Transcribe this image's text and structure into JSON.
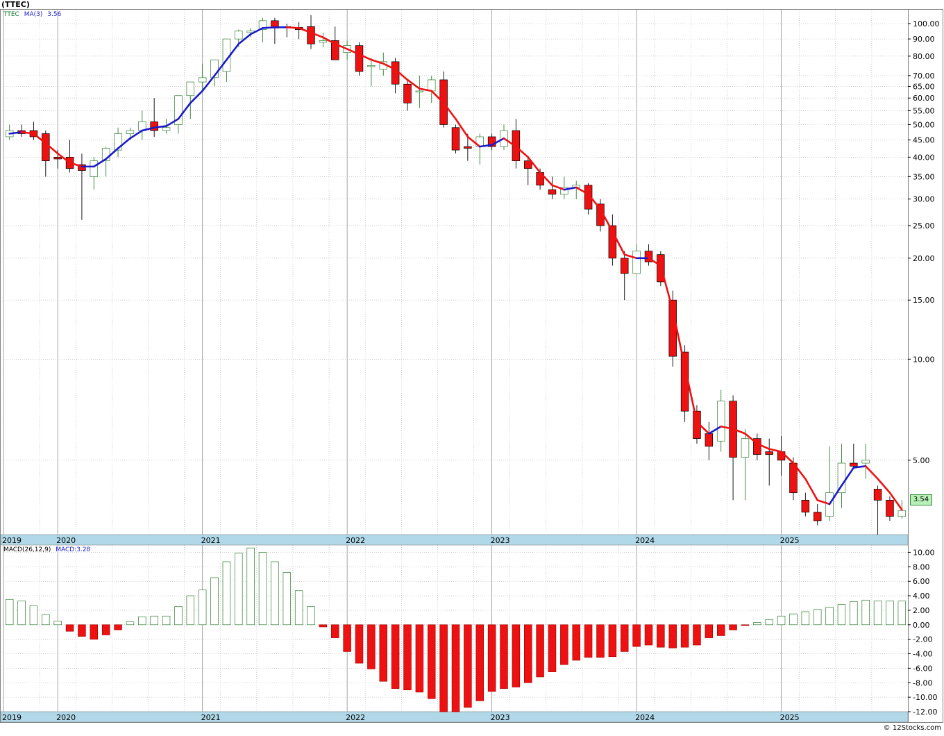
{
  "title": "(TTEC)",
  "legend": {
    "ticker": "TTEC",
    "ma_label": "MA(3)",
    "ma_value": "3.56"
  },
  "macd_legend": {
    "label": "MACD(26,12,9)",
    "value_label": "MACD:3.28"
  },
  "last_price_label": "3.54",
  "credit": "© 12Stocks.com",
  "colors": {
    "up": "#2e7d2e",
    "down": "#ee1111",
    "ma_up": "#1a1acc",
    "ma_down": "#ee1111",
    "grid": "#b0b0b0",
    "axis_bar": "#b0d8e8"
  },
  "chart_data": [
    {
      "type": "candlestick",
      "title": "(TTEC)",
      "scale": "log",
      "ylim": [
        3.0,
        110
      ],
      "x_labels": [
        "2019",
        "2020",
        "2021",
        "2022",
        "2023",
        "2024",
        "2025"
      ],
      "y_ticks": [
        "100.00",
        "90.00",
        "80.00",
        "70.00",
        "65.00",
        "60.00",
        "55.00",
        "50.00",
        "45.00",
        "40.00",
        "35.00",
        "30.00",
        "25.00",
        "20.00",
        "15.00",
        "10.00",
        "5.00"
      ],
      "y_tick_values": [
        100,
        90,
        80,
        70,
        65,
        60,
        55,
        50,
        45,
        40,
        35,
        30,
        25,
        20,
        15,
        10,
        5
      ],
      "candles": [
        {
          "o": 46.0,
          "h": 50.0,
          "l": 45.0,
          "c": 48.0
        },
        {
          "o": 48.0,
          "h": 50.0,
          "l": 46.0,
          "c": 47.0
        },
        {
          "o": 48.0,
          "h": 51.0,
          "l": 45.0,
          "c": 46.0
        },
        {
          "o": 47.0,
          "h": 48.0,
          "l": 35.0,
          "c": 39.0
        },
        {
          "o": 40.0,
          "h": 42.0,
          "l": 37.0,
          "c": 39.5
        },
        {
          "o": 40.0,
          "h": 45.0,
          "l": 36.0,
          "c": 37.0
        },
        {
          "o": 38.0,
          "h": 41.0,
          "l": 26.0,
          "c": 36.5
        },
        {
          "o": 35.0,
          "h": 40.0,
          "l": 32.0,
          "c": 39.0
        },
        {
          "o": 39.0,
          "h": 43.0,
          "l": 35.0,
          "c": 42.5
        },
        {
          "o": 42.0,
          "h": 49.0,
          "l": 40.0,
          "c": 47.0
        },
        {
          "o": 47.0,
          "h": 49.0,
          "l": 45.0,
          "c": 48.0
        },
        {
          "o": 48.0,
          "h": 55.0,
          "l": 45.0,
          "c": 51.0
        },
        {
          "o": 51.0,
          "h": 60.0,
          "l": 46.0,
          "c": 48.0
        },
        {
          "o": 48.0,
          "h": 52.0,
          "l": 47.0,
          "c": 49.0
        },
        {
          "o": 50.0,
          "h": 56.0,
          "l": 47.0,
          "c": 61.0
        },
        {
          "o": 61.0,
          "h": 66.0,
          "l": 52.0,
          "c": 67.0
        },
        {
          "o": 67.0,
          "h": 76.0,
          "l": 63.0,
          "c": 69.0
        },
        {
          "o": 69.0,
          "h": 78.0,
          "l": 65.0,
          "c": 78.0
        },
        {
          "o": 72.0,
          "h": 82.0,
          "l": 67.0,
          "c": 90.0
        },
        {
          "o": 90.0,
          "h": 96.0,
          "l": 85.0,
          "c": 95.0
        },
        {
          "o": 94.0,
          "h": 97.0,
          "l": 91.0,
          "c": 95.0
        },
        {
          "o": 96.0,
          "h": 104.0,
          "l": 88.0,
          "c": 102.0
        },
        {
          "o": 102.0,
          "h": 104.0,
          "l": 87.0,
          "c": 97.0
        },
        {
          "o": 98.0,
          "h": 100.0,
          "l": 91.0,
          "c": 97.5
        },
        {
          "o": 97.5,
          "h": 101.0,
          "l": 90.0,
          "c": 96.0
        },
        {
          "o": 98.0,
          "h": 106.0,
          "l": 84.0,
          "c": 87.0
        },
        {
          "o": 88.0,
          "h": 94.0,
          "l": 85.0,
          "c": 89.0
        },
        {
          "o": 89.0,
          "h": 98.0,
          "l": 82.0,
          "c": 78.0
        },
        {
          "o": 82.0,
          "h": 89.0,
          "l": 78.0,
          "c": 86.0
        },
        {
          "o": 86.0,
          "h": 88.0,
          "l": 70.0,
          "c": 72.0
        },
        {
          "o": 75.0,
          "h": 79.0,
          "l": 65.0,
          "c": 75.0
        },
        {
          "o": 73.0,
          "h": 82.0,
          "l": 70.0,
          "c": 77.0
        },
        {
          "o": 77.0,
          "h": 79.0,
          "l": 62.0,
          "c": 66.0
        },
        {
          "o": 66.0,
          "h": 68.0,
          "l": 55.0,
          "c": 58.0
        },
        {
          "o": 63.0,
          "h": 70.0,
          "l": 56.0,
          "c": 63.0
        },
        {
          "o": 63.0,
          "h": 70.0,
          "l": 58.0,
          "c": 68.0
        },
        {
          "o": 68.0,
          "h": 72.0,
          "l": 49.0,
          "c": 50.0
        },
        {
          "o": 49.0,
          "h": 50.0,
          "l": 41.0,
          "c": 42.0
        },
        {
          "o": 43.0,
          "h": 47.0,
          "l": 39.0,
          "c": 42.5
        },
        {
          "o": 43.0,
          "h": 47.0,
          "l": 38.0,
          "c": 46.0
        },
        {
          "o": 46.0,
          "h": 47.0,
          "l": 42.0,
          "c": 43.0
        },
        {
          "o": 43.0,
          "h": 50.0,
          "l": 42.0,
          "c": 48.0
        },
        {
          "o": 48.0,
          "h": 52.0,
          "l": 37.0,
          "c": 39.0
        },
        {
          "o": 39.0,
          "h": 40.0,
          "l": 33.0,
          "c": 37.0
        },
        {
          "o": 36.0,
          "h": 37.0,
          "l": 32.0,
          "c": 33.0
        },
        {
          "o": 32.0,
          "h": 35.0,
          "l": 30.0,
          "c": 31.0
        },
        {
          "o": 31.0,
          "h": 35.0,
          "l": 30.0,
          "c": 32.5
        },
        {
          "o": 32.5,
          "h": 34.0,
          "l": 30.0,
          "c": 33.0
        },
        {
          "o": 33.0,
          "h": 33.5,
          "l": 27.0,
          "c": 28.0
        },
        {
          "o": 29.0,
          "h": 30.0,
          "l": 24.0,
          "c": 25.0
        },
        {
          "o": 25.0,
          "h": 27.0,
          "l": 19.0,
          "c": 20.0
        },
        {
          "o": 20.0,
          "h": 21.0,
          "l": 15.0,
          "c": 18.0
        },
        {
          "o": 18.0,
          "h": 22.0,
          "l": 18.0,
          "c": 21.0
        },
        {
          "o": 21.0,
          "h": 22.0,
          "l": 19.0,
          "c": 19.5
        },
        {
          "o": 20.5,
          "h": 21.0,
          "l": 16.5,
          "c": 17.0
        },
        {
          "o": 15.0,
          "h": 16.0,
          "l": 9.5,
          "c": 10.2
        },
        {
          "o": 10.5,
          "h": 11.0,
          "l": 6.5,
          "c": 7.0
        },
        {
          "o": 7.0,
          "h": 7.3,
          "l": 5.6,
          "c": 5.8
        },
        {
          "o": 6.0,
          "h": 6.5,
          "l": 5.0,
          "c": 5.5
        },
        {
          "o": 5.7,
          "h": 8.1,
          "l": 5.3,
          "c": 7.5
        },
        {
          "o": 7.5,
          "h": 7.8,
          "l": 3.8,
          "c": 5.1
        },
        {
          "o": 5.1,
          "h": 6.2,
          "l": 3.8,
          "c": 5.8
        },
        {
          "o": 5.8,
          "h": 6.0,
          "l": 5.0,
          "c": 5.2
        },
        {
          "o": 5.3,
          "h": 5.8,
          "l": 4.2,
          "c": 5.2
        },
        {
          "o": 5.3,
          "h": 5.9,
          "l": 4.5,
          "c": 5.0
        },
        {
          "o": 4.9,
          "h": 5.1,
          "l": 3.8,
          "c": 4.0
        },
        {
          "o": 3.8,
          "h": 4.0,
          "l": 3.4,
          "c": 3.5
        },
        {
          "o": 3.5,
          "h": 3.7,
          "l": 3.2,
          "c": 3.3
        },
        {
          "o": 3.4,
          "h": 5.5,
          "l": 3.3,
          "c": 4.0
        },
        {
          "o": 4.0,
          "h": 5.6,
          "l": 3.6,
          "c": 4.9
        },
        {
          "o": 4.9,
          "h": 5.6,
          "l": 4.7,
          "c": 4.8
        },
        {
          "o": 4.9,
          "h": 5.6,
          "l": 4.4,
          "c": 5.0
        },
        {
          "o": 4.1,
          "h": 4.2,
          "l": 3.0,
          "c": 3.8
        },
        {
          "o": 3.8,
          "h": 3.9,
          "l": 3.3,
          "c": 3.4
        },
        {
          "o": 3.4,
          "h": 3.8,
          "l": 3.35,
          "c": 3.54
        }
      ],
      "ma3": [
        47,
        47.5,
        47,
        44,
        41,
        38.5,
        37.5,
        37.5,
        39.5,
        42.5,
        45.5,
        48,
        49,
        49.5,
        52,
        58,
        63,
        70,
        78,
        87,
        93,
        97,
        97.5,
        97.5,
        97,
        94,
        91,
        87,
        84,
        81,
        78,
        76,
        73,
        68,
        64,
        63,
        58,
        52,
        46,
        43,
        43.5,
        45.5,
        43,
        40,
        36,
        33,
        32,
        32.5,
        31,
        28,
        24,
        20.5,
        20,
        20,
        19,
        14,
        9.5,
        6.5,
        6.0,
        6.3,
        6.2,
        6.0,
        5.6,
        5.4,
        5.3,
        4.9,
        4.4,
        3.8,
        3.7,
        4.2,
        4.75,
        4.8,
        4.4,
        4.0,
        3.56
      ]
    },
    {
      "type": "histogram",
      "title": "MACD(26,12,9)",
      "ylim": [
        -12,
        11
      ],
      "y_ticks": [
        "10.00",
        "8.00",
        "6.00",
        "4.00",
        "2.00",
        "0.00",
        "-2.00",
        "-4.00",
        "-6.00",
        "-8.00",
        "-10.00",
        "-12.00"
      ],
      "y_tick_values": [
        10,
        8,
        6,
        4,
        2,
        0,
        -2,
        -4,
        -6,
        -8,
        -10,
        -12
      ],
      "values": [
        3.5,
        3.3,
        2.6,
        1.4,
        0.5,
        -0.9,
        -1.6,
        -2.0,
        -1.4,
        -0.7,
        0.4,
        1.1,
        1.2,
        1.2,
        2.5,
        4.0,
        4.8,
        6.5,
        8.7,
        9.9,
        10.6,
        10.0,
        8.7,
        7.2,
        4.7,
        2.5,
        -0.3,
        -1.8,
        -3.7,
        -5.3,
        -6.1,
        -7.8,
        -8.8,
        -9.0,
        -9.3,
        -10.2,
        -12.0,
        -12.0,
        -11.4,
        -10.5,
        -9.2,
        -8.8,
        -8.6,
        -8.0,
        -7.2,
        -6.5,
        -5.5,
        -4.9,
        -4.5,
        -4.5,
        -4.4,
        -3.7,
        -3.0,
        -2.8,
        -3.1,
        -3.2,
        -3.1,
        -2.8,
        -1.8,
        -1.5,
        -0.7,
        -0.1,
        0.3,
        0.7,
        1.2,
        1.5,
        1.8,
        2.1,
        2.4,
        2.8,
        3.2,
        3.4,
        3.3,
        3.3,
        3.28
      ],
      "x_labels": [
        "2019",
        "2020",
        "2021",
        "2022",
        "2023",
        "2024",
        "2025"
      ]
    }
  ]
}
